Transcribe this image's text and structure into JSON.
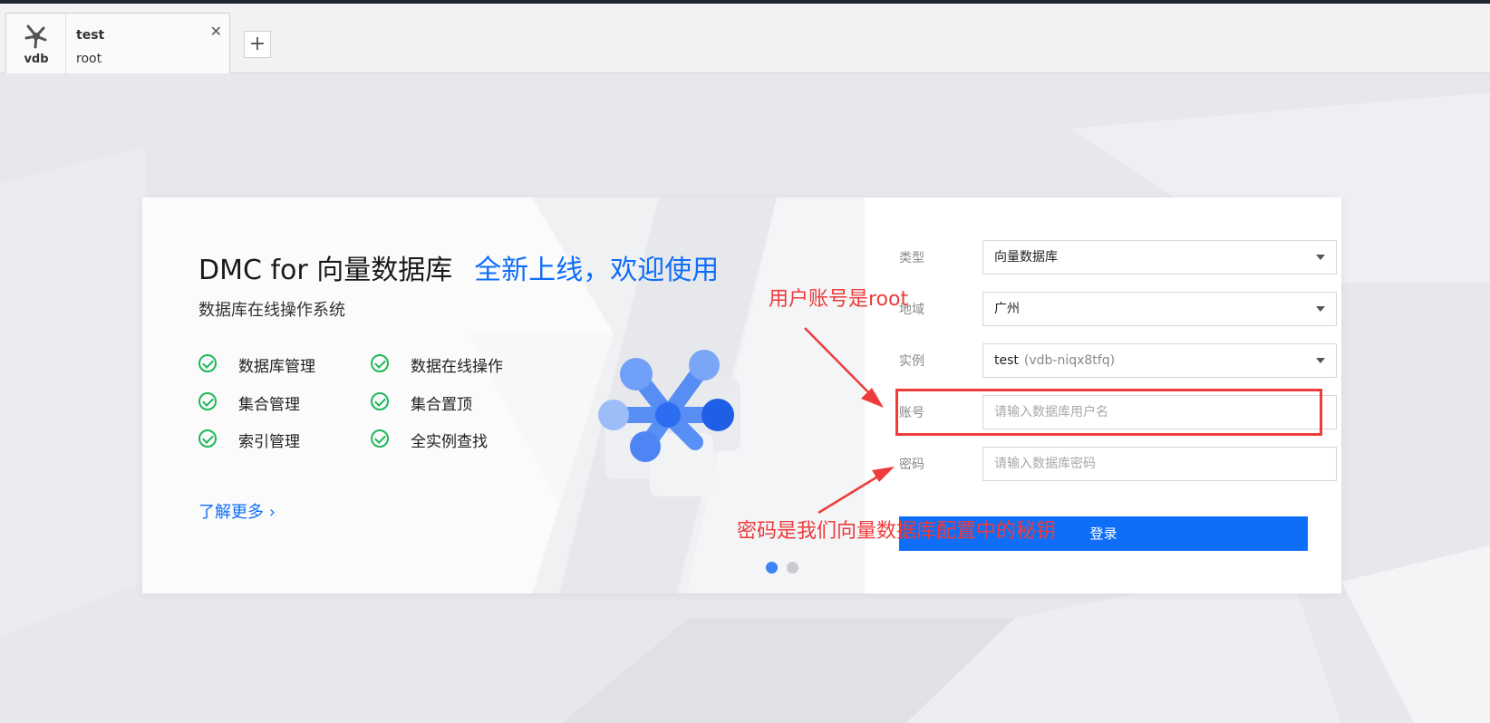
{
  "tab": {
    "logo_text": "vdb",
    "title": "test",
    "user": "root",
    "close_glyph": "✕",
    "add_glyph": "+"
  },
  "hero": {
    "title": "DMC for 向量数据库",
    "title_accent": "全新上线，欢迎使用",
    "subtitle": "数据库在线操作系统",
    "features": [
      "数据库管理",
      "数据在线操作",
      "集合管理",
      "集合置顶",
      "索引管理",
      "全实例查找"
    ],
    "more_link": "了解更多 ›",
    "carousel_active_index": 0
  },
  "form": {
    "type_label": "类型",
    "type_value": "向量数据库",
    "region_label": "地域",
    "region_value": "广州",
    "instance_label": "实例",
    "instance_value": "test",
    "instance_id": "(vdb-niqx8tfq)",
    "account_label": "账号",
    "account_placeholder": "请输入数据库用户名",
    "password_label": "密码",
    "password_placeholder": "请输入数据库密码",
    "login_label": "登录"
  },
  "annotations": {
    "account_note": "用户账号是root",
    "password_note": "密码是我们向量数据库配置中的秘钥"
  },
  "colors": {
    "accent": "#0f6ef7",
    "check": "#1fb85a",
    "annotation": "#ee3b3b",
    "dot_active": "#3c83f6",
    "dot_inactive": "#c9cbd0"
  }
}
